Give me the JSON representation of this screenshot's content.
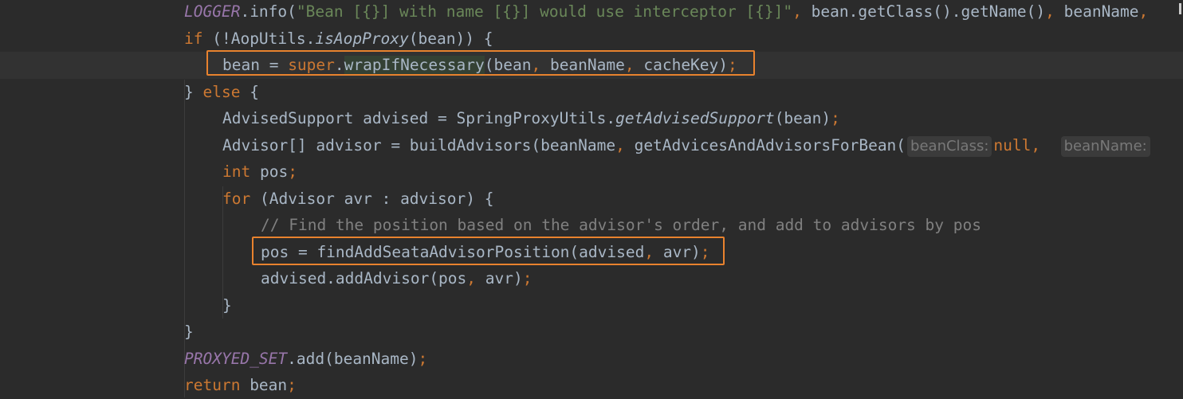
{
  "lines": [
    {
      "indent": 231,
      "tokens": [
        {
          "t": "LOGGER",
          "c": "static"
        },
        {
          "t": ".info(",
          "c": ""
        },
        {
          "t": "\"Bean [{}] with name [{}] would use interceptor [{}]\"",
          "c": "str"
        },
        {
          "t": ", ",
          "c": "punct"
        },
        {
          "t": "bean.getClass().getName()",
          "c": ""
        },
        {
          "t": ", ",
          "c": "punct"
        },
        {
          "t": "beanName",
          "c": ""
        },
        {
          "t": ", ",
          "c": "punct"
        }
      ]
    },
    {
      "indent": 231,
      "tokens": [
        {
          "t": "if ",
          "c": "kw"
        },
        {
          "t": "(!AopUtils.",
          "c": ""
        },
        {
          "t": "isAopProxy",
          "c": "it"
        },
        {
          "t": "(bean)) {",
          "c": ""
        }
      ]
    },
    {
      "indent": 279,
      "current": true,
      "tokens": [
        {
          "t": "bean = ",
          "c": ""
        },
        {
          "t": "super",
          "c": "kw"
        },
        {
          "t": ".",
          "c": ""
        },
        {
          "t": "wrapIfNec",
          "c": "hl"
        },
        {
          "t": "",
          "c": "caret"
        },
        {
          "t": "essary",
          "c": "hl"
        },
        {
          "t": "(bean",
          "c": ""
        },
        {
          "t": ", ",
          "c": "punct"
        },
        {
          "t": "beanName",
          "c": ""
        },
        {
          "t": ", ",
          "c": "punct"
        },
        {
          "t": "cacheKey)",
          "c": ""
        },
        {
          "t": ";",
          "c": "punct"
        }
      ]
    },
    {
      "indent": 231,
      "tokens": [
        {
          "t": "} ",
          "c": ""
        },
        {
          "t": "else ",
          "c": "kw"
        },
        {
          "t": "{",
          "c": ""
        }
      ]
    },
    {
      "indent": 279,
      "tokens": [
        {
          "t": "AdvisedSupport advised = SpringProxyUtils.",
          "c": ""
        },
        {
          "t": "getAdvisedSupport",
          "c": "it"
        },
        {
          "t": "(bean)",
          "c": ""
        },
        {
          "t": ";",
          "c": "punct"
        }
      ]
    },
    {
      "indent": 279,
      "tokens": [
        {
          "t": "Advisor[] advisor = buildAdvisors(beanName",
          "c": ""
        },
        {
          "t": ", ",
          "c": "punct"
        },
        {
          "t": "getAdvicesAndAdvisorsForBean(",
          "c": ""
        },
        {
          "t": "beanClass:",
          "c": "hint"
        },
        {
          "t": "null",
          "c": "kw"
        },
        {
          "t": ",  ",
          "c": "punct"
        },
        {
          "t": "beanName:",
          "c": "hint"
        }
      ]
    },
    {
      "indent": 279,
      "tokens": [
        {
          "t": "int ",
          "c": "kw"
        },
        {
          "t": "pos",
          "c": ""
        },
        {
          "t": ";",
          "c": "punct"
        }
      ]
    },
    {
      "indent": 279,
      "tokens": [
        {
          "t": "for ",
          "c": "kw"
        },
        {
          "t": "(Advisor avr : advisor) {",
          "c": ""
        }
      ]
    },
    {
      "indent": 327,
      "tokens": [
        {
          "t": "// Find the position based on the advisor's order, and add to advisors by pos",
          "c": "cm"
        }
      ]
    },
    {
      "indent": 327,
      "tokens": [
        {
          "t": "pos = findAddSeataAdvisorPosition(advised",
          "c": ""
        },
        {
          "t": ", ",
          "c": "punct"
        },
        {
          "t": "avr)",
          "c": ""
        },
        {
          "t": ";",
          "c": "punct"
        }
      ]
    },
    {
      "indent": 327,
      "tokens": [
        {
          "t": "advised.addAdvisor(pos",
          "c": ""
        },
        {
          "t": ", ",
          "c": "punct"
        },
        {
          "t": "avr)",
          "c": ""
        },
        {
          "t": ";",
          "c": "punct"
        }
      ]
    },
    {
      "indent": 279,
      "tokens": [
        {
          "t": "}",
          "c": ""
        }
      ]
    },
    {
      "indent": 231,
      "tokens": [
        {
          "t": "}",
          "c": ""
        }
      ]
    },
    {
      "indent": 231,
      "tokens": [
        {
          "t": "PROXYED_SET",
          "c": "static"
        },
        {
          "t": ".add(beanName)",
          "c": ""
        },
        {
          "t": ";",
          "c": "punct"
        }
      ]
    },
    {
      "indent": 231,
      "tokens": [
        {
          "t": "return ",
          "c": "kw"
        },
        {
          "t": "bean",
          "c": ""
        },
        {
          "t": ";",
          "c": "punct"
        }
      ]
    }
  ],
  "highlights": {
    "box_color": "#e8822e",
    "boxed_lines": [
      "bean = super.wrapIfNecessary(bean, beanName, cacheKey);",
      "pos = findAddSeataAdvisorPosition(advised, avr);"
    ]
  },
  "theme": {
    "background": "#2b2b2b",
    "keyword": "#cc7832",
    "string": "#6a8759",
    "static_field": "#9876aa",
    "comment": "#808080",
    "default": "#a9b7c6"
  }
}
